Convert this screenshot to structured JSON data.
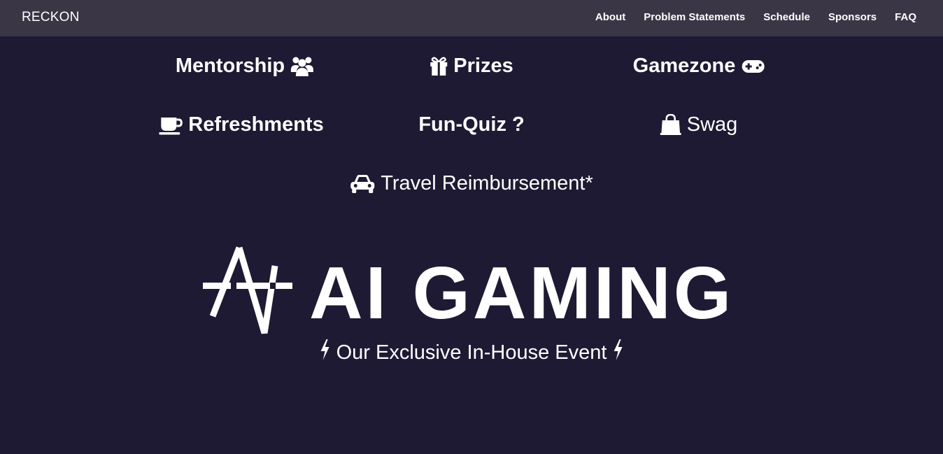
{
  "navbar": {
    "brand": "RECKON",
    "links": [
      "About",
      "Problem Statements",
      "Schedule",
      "Sponsors",
      "FAQ"
    ]
  },
  "features": {
    "mentorship": {
      "label": "Mentorship",
      "icon": "users-icon"
    },
    "prizes": {
      "label": "Prizes",
      "icon": "gift-icon"
    },
    "gamezone": {
      "label": "Gamezone",
      "icon": "gamepad-icon"
    },
    "refreshments": {
      "label": "Refreshments",
      "icon": "coffee-icon"
    },
    "funquiz": {
      "label": "Fun-Quiz",
      "icon": "question-icon"
    },
    "swag": {
      "label": "Swag",
      "icon": "shopping-bag-icon"
    },
    "travel": {
      "label": "Travel Reimbursement*",
      "icon": "car-icon"
    }
  },
  "event": {
    "logo_text": "AI GAMING",
    "tagline": "Our Exclusive In-House Event"
  },
  "colors": {
    "background": "#1f1a33",
    "navbar": "#3b3646",
    "text": "#ffffff"
  }
}
